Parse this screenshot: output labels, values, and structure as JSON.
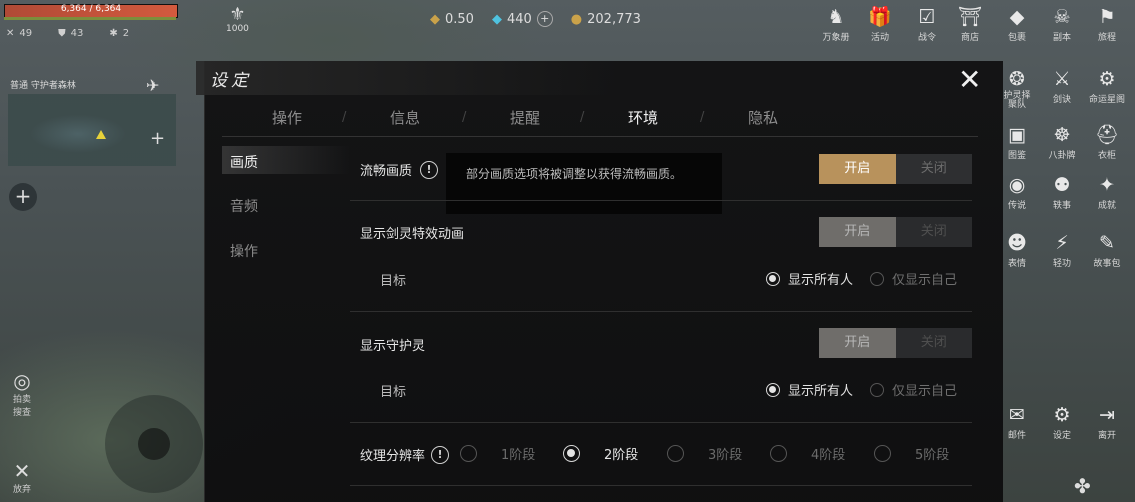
{
  "hud": {
    "hp_text": "6,364 / 6,364",
    "stats": [
      {
        "icon": "crossed-swords-icon",
        "glyph": "✕",
        "value": "49"
      },
      {
        "icon": "shield-icon",
        "glyph": "⛊",
        "value": "43"
      },
      {
        "icon": "star-burst-icon",
        "glyph": "✱",
        "value": "2"
      }
    ],
    "level_value": "1000",
    "currency_a": "0.50",
    "currency_b": "440",
    "gold": "202,773",
    "map_location": "普通  守护者森林",
    "left_icons": [
      {
        "name": "radar-icon",
        "glyph": "◎",
        "label": "拍卖\n搜查"
      },
      {
        "name": "weapon-icon",
        "glyph": "✕",
        "label": "放弃"
      }
    ]
  },
  "right_menu": [
    {
      "name": "encyclopedia-icon",
      "glyph": "♞",
      "label": "万象册"
    },
    {
      "name": "event-gift-icon",
      "glyph": "🎁",
      "label": "活动"
    },
    {
      "name": "battle-pass-icon",
      "glyph": "☑",
      "label": "战令"
    },
    {
      "name": "shop-icon",
      "glyph": "⛩",
      "label": "商店"
    },
    {
      "name": "bag-icon",
      "glyph": "◆",
      "label": "包裹"
    },
    {
      "name": "dungeon-icon",
      "glyph": "☠",
      "label": "副本"
    },
    {
      "name": "journey-icon",
      "glyph": "⚑",
      "label": "旅程"
    },
    {
      "name": "guardian-icon",
      "glyph": "❂",
      "label": "护灵择\n聚队"
    },
    {
      "name": "sword-art-icon",
      "glyph": "⚔",
      "label": "剑诀"
    },
    {
      "name": "fate-icon",
      "glyph": "⚙",
      "label": "命运星阁"
    },
    {
      "name": "album-icon",
      "glyph": "▣",
      "label": "图鉴"
    },
    {
      "name": "bagua-icon",
      "glyph": "☸",
      "label": "八卦牌"
    },
    {
      "name": "wardrobe-icon",
      "glyph": "⛑",
      "label": "衣柜"
    },
    {
      "name": "legend-icon",
      "glyph": "◉",
      "label": "传说"
    },
    {
      "name": "story-icon",
      "glyph": "⚉",
      "label": "轶事"
    },
    {
      "name": "achievement-icon",
      "glyph": "✦",
      "label": "成就"
    },
    {
      "name": "emote-icon",
      "glyph": "☻",
      "label": "表情"
    },
    {
      "name": "lightness-icon",
      "glyph": "⚡",
      "label": "轻功"
    },
    {
      "name": "storybook-icon",
      "glyph": "✎",
      "label": "故事包"
    },
    {
      "name": "mail-icon",
      "glyph": "✉",
      "label": "邮件"
    },
    {
      "name": "settings-icon",
      "glyph": "⚙",
      "label": "设定"
    },
    {
      "name": "exit-icon",
      "glyph": "⇥",
      "label": "离开"
    }
  ],
  "settings": {
    "title": "设定",
    "close_glyph": "✕",
    "tabs": [
      "操作",
      "信息",
      "提醒",
      "环境",
      "隐私"
    ],
    "active_tab": "环境",
    "side": [
      "画质",
      "音频",
      "操作"
    ],
    "smooth_quality": {
      "label": "流畅画质",
      "tooltip": "部分画质选项将被调整以获得流畅画质。",
      "on": "开启",
      "off": "关闭"
    },
    "sword_spirit_fx": {
      "label": "显示剑灵特效动画",
      "on": "开启",
      "off": "关闭",
      "target_label": "目标",
      "opt_all": "显示所有人",
      "opt_self": "仅显示自己"
    },
    "guardian": {
      "label": "显示守护灵",
      "on": "开启",
      "off": "关闭",
      "target_label": "目标",
      "opt_all": "显示所有人",
      "opt_self": "仅显示自己"
    },
    "texture": {
      "label": "纹理分辨率",
      "stages": [
        "1阶段",
        "2阶段",
        "3阶段",
        "4阶段",
        "5阶段"
      ],
      "selected": "2阶段"
    }
  }
}
